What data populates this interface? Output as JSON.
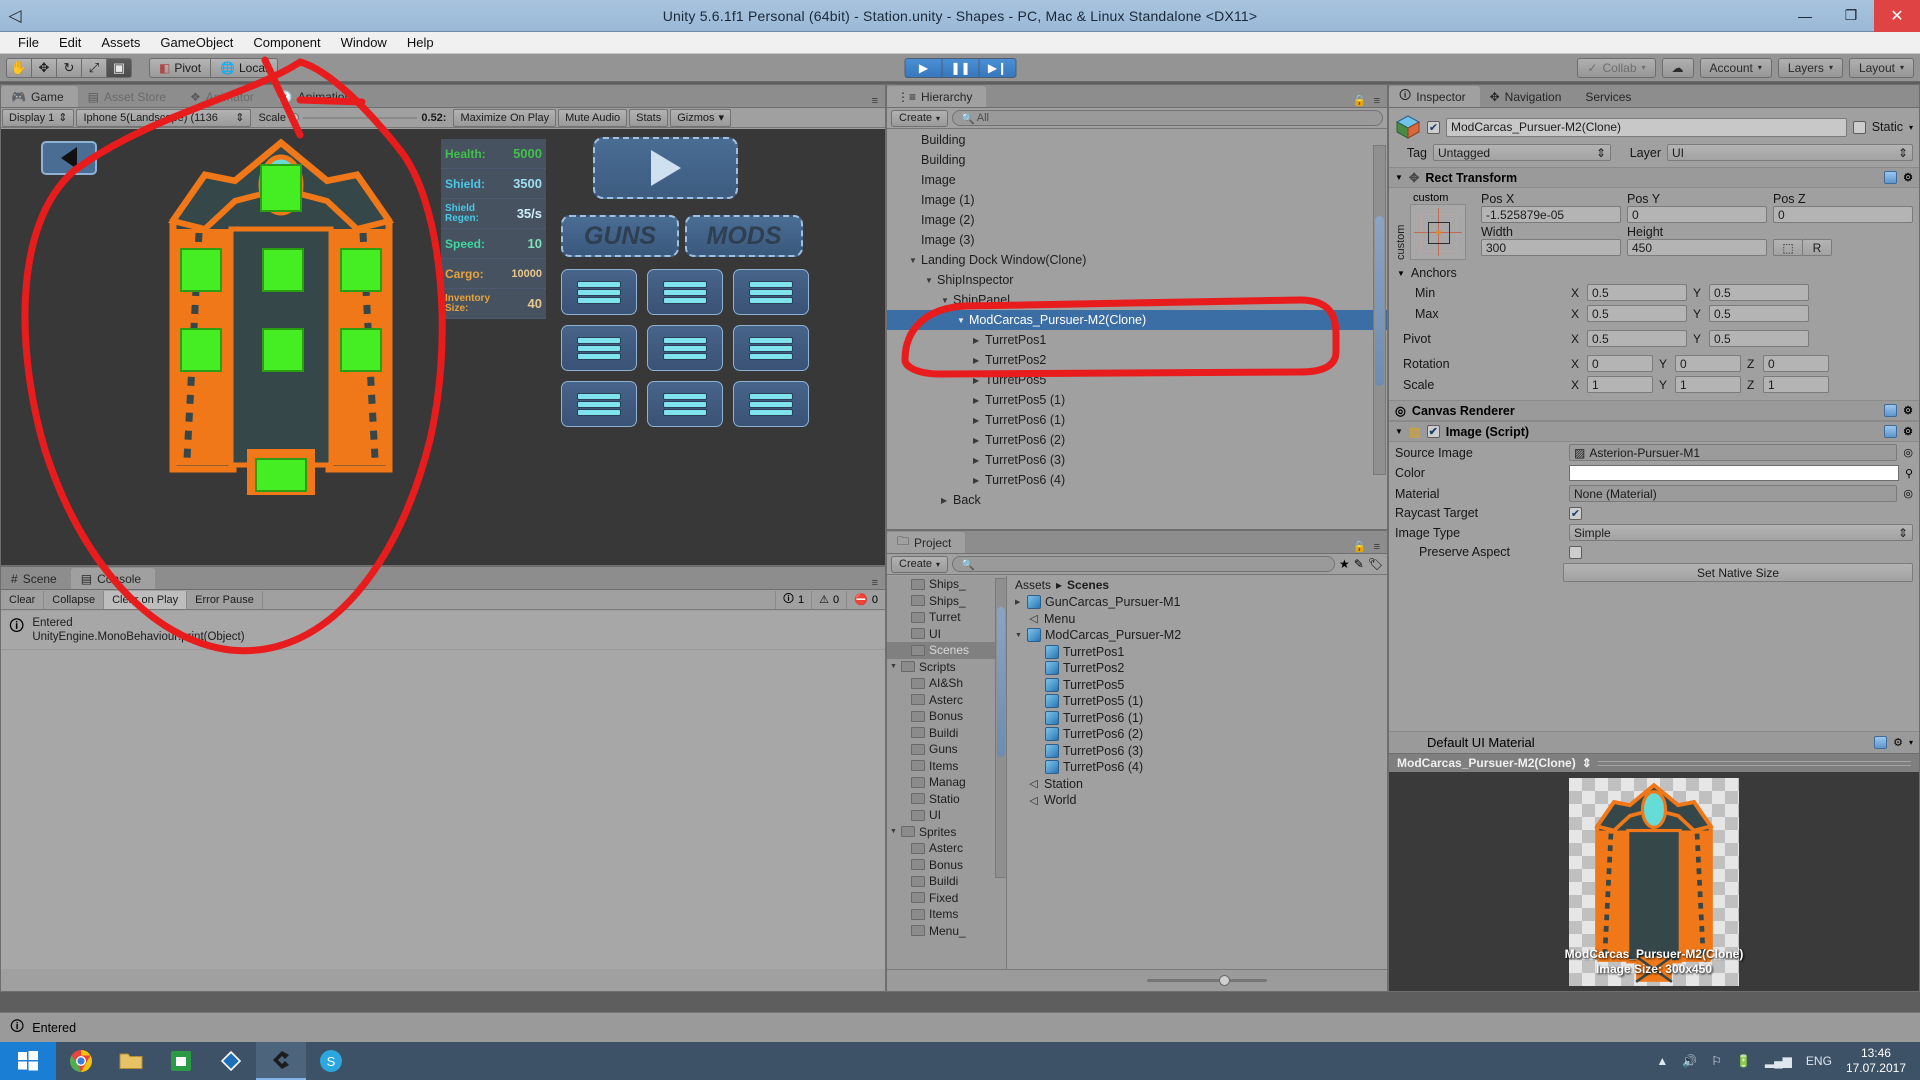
{
  "window": {
    "title": "Unity 5.6.1f1 Personal (64bit) - Station.unity - Shapes - PC, Mac & Linux Standalone <DX11>",
    "minimize": "—",
    "maximize": "❐",
    "close": "✕"
  },
  "menu": [
    "File",
    "Edit",
    "Assets",
    "GameObject",
    "Component",
    "Window",
    "Help"
  ],
  "toolbar": {
    "tools": [
      "hand-tool",
      "move-tool",
      "rotate-tool",
      "scale-tool",
      "rect-tool"
    ],
    "pivot_label": "Pivot",
    "local_label": "Local",
    "play": "▶",
    "pause": "❚❚",
    "step": "▶❙",
    "collab_label": "Collab",
    "account_label": "Account",
    "layers_label": "Layers",
    "layout_label": "Layout"
  },
  "game_view": {
    "tabs": [
      "Game",
      "Asset Store",
      "Animator",
      "Animation"
    ],
    "selected_tab": "Game",
    "display": "Display 1",
    "resolution": "Iphone 5(Landscape) (1136",
    "scale_label": "Scale",
    "scale_value": "0.52:",
    "maximize_on_play": "Maximize On Play",
    "mute_audio": "Mute Audio",
    "stats": "Stats",
    "gizmos": "Gizmos",
    "ship_stats": [
      {
        "label": "Health:",
        "value": "5000",
        "color": "#3fc14a"
      },
      {
        "label": "Shield:",
        "value": "3500",
        "color": "#49c8e8"
      },
      {
        "label": "Shield Regen:",
        "value": "35/s",
        "color": "#49c8e8"
      },
      {
        "label": "Speed:",
        "value": "10",
        "color": "#3fd6a0"
      },
      {
        "label": "Cargo:",
        "value": "10000",
        "color": "#e8a33d"
      },
      {
        "label": "Inventory Size:",
        "value": "40",
        "color": "#e8a33d"
      }
    ],
    "panel_tabs": [
      "GUNS",
      "MODS"
    ],
    "slot_count": 9
  },
  "console": {
    "tabs": [
      "Scene",
      "Console"
    ],
    "selected_tab": "Console",
    "buttons": [
      "Clear",
      "Collapse",
      "Clear on Play",
      "Error Pause"
    ],
    "counts": {
      "info": "1",
      "warning": "0",
      "error": "0"
    },
    "entries": [
      {
        "line1": "Entered",
        "line2": "UnityEngine.MonoBehaviour:print(Object)"
      }
    ],
    "status": "Entered"
  },
  "hierarchy": {
    "tab": "Hierarchy",
    "create_label": "Create",
    "search_placeholder": "All",
    "items": [
      {
        "label": "Building",
        "indent": 1,
        "arrow": "",
        "selected": false
      },
      {
        "label": "Building",
        "indent": 1,
        "arrow": "",
        "selected": false
      },
      {
        "label": "Image",
        "indent": 1,
        "arrow": "",
        "selected": false
      },
      {
        "label": "Image (1)",
        "indent": 1,
        "arrow": "",
        "selected": false
      },
      {
        "label": "Image (2)",
        "indent": 1,
        "arrow": "",
        "selected": false
      },
      {
        "label": "Image (3)",
        "indent": 1,
        "arrow": "",
        "selected": false
      },
      {
        "label": "Landing Dock Window(Clone)",
        "indent": 1,
        "arrow": "▼",
        "selected": false
      },
      {
        "label": "ShipInspector",
        "indent": 2,
        "arrow": "▼",
        "selected": false
      },
      {
        "label": "ShipPanel",
        "indent": 3,
        "arrow": "▼",
        "selected": false
      },
      {
        "label": "ModCarcas_Pursuer-M2(Clone)",
        "indent": 4,
        "arrow": "▼",
        "selected": true
      },
      {
        "label": "TurretPos1",
        "indent": 5,
        "arrow": "▶",
        "selected": false
      },
      {
        "label": "TurretPos2",
        "indent": 5,
        "arrow": "▶",
        "selected": false
      },
      {
        "label": "TurretPos5",
        "indent": 5,
        "arrow": "▶",
        "selected": false
      },
      {
        "label": "TurretPos5 (1)",
        "indent": 5,
        "arrow": "▶",
        "selected": false
      },
      {
        "label": "TurretPos6 (1)",
        "indent": 5,
        "arrow": "▶",
        "selected": false
      },
      {
        "label": "TurretPos6 (2)",
        "indent": 5,
        "arrow": "▶",
        "selected": false
      },
      {
        "label": "TurretPos6 (3)",
        "indent": 5,
        "arrow": "▶",
        "selected": false
      },
      {
        "label": "TurretPos6 (4)",
        "indent": 5,
        "arrow": "▶",
        "selected": false
      },
      {
        "label": "Back",
        "indent": 3,
        "arrow": "▶",
        "selected": false
      }
    ]
  },
  "project": {
    "tab": "Project",
    "create_label": "Create",
    "search_placeholder": "",
    "tree": [
      {
        "label": "Ships_",
        "indent": 1,
        "arrow": "",
        "selected": false
      },
      {
        "label": "Ships_",
        "indent": 1,
        "arrow": "",
        "selected": false
      },
      {
        "label": "Turret",
        "indent": 1,
        "arrow": "",
        "selected": false
      },
      {
        "label": "UI",
        "indent": 1,
        "arrow": "",
        "selected": false
      },
      {
        "label": "Scenes",
        "indent": 1,
        "arrow": "",
        "selected": true
      },
      {
        "label": "Scripts",
        "indent": 0,
        "arrow": "▼",
        "selected": false
      },
      {
        "label": "AI&Sh",
        "indent": 1,
        "arrow": "",
        "selected": false
      },
      {
        "label": "Asterc",
        "indent": 1,
        "arrow": "",
        "selected": false
      },
      {
        "label": "Bonus",
        "indent": 1,
        "arrow": "",
        "selected": false
      },
      {
        "label": "Buildi",
        "indent": 1,
        "arrow": "",
        "selected": false
      },
      {
        "label": "Guns",
        "indent": 1,
        "arrow": "",
        "selected": false
      },
      {
        "label": "Items",
        "indent": 1,
        "arrow": "",
        "selected": false
      },
      {
        "label": "Manag",
        "indent": 1,
        "arrow": "",
        "selected": false
      },
      {
        "label": "Statio",
        "indent": 1,
        "arrow": "",
        "selected": false
      },
      {
        "label": "UI",
        "indent": 1,
        "arrow": "",
        "selected": false
      },
      {
        "label": "Sprites",
        "indent": 0,
        "arrow": "▼",
        "selected": false
      },
      {
        "label": "Asterc",
        "indent": 1,
        "arrow": "",
        "selected": false
      },
      {
        "label": "Bonus",
        "indent": 1,
        "arrow": "",
        "selected": false
      },
      {
        "label": "Buildi",
        "indent": 1,
        "arrow": "",
        "selected": false
      },
      {
        "label": "Fixed",
        "indent": 1,
        "arrow": "",
        "selected": false
      },
      {
        "label": "Items",
        "indent": 1,
        "arrow": "",
        "selected": false
      },
      {
        "label": "Menu_",
        "indent": 1,
        "arrow": "",
        "selected": false
      }
    ],
    "breadcrumb": [
      "Assets",
      "Scenes"
    ],
    "contents": [
      {
        "label": "GunCarcas_Pursuer-M1",
        "indent": 0,
        "arrow": "▶",
        "icon": "prefab-cube"
      },
      {
        "label": "Menu",
        "indent": 0,
        "arrow": "",
        "icon": "unity-scene"
      },
      {
        "label": "ModCarcas_Pursuer-M2",
        "indent": 0,
        "arrow": "▼",
        "icon": "prefab-cube"
      },
      {
        "label": "TurretPos1",
        "indent": 1,
        "arrow": "",
        "icon": "prefab-cube"
      },
      {
        "label": "TurretPos2",
        "indent": 1,
        "arrow": "",
        "icon": "prefab-cube"
      },
      {
        "label": "TurretPos5",
        "indent": 1,
        "arrow": "",
        "icon": "prefab-cube"
      },
      {
        "label": "TurretPos5 (1)",
        "indent": 1,
        "arrow": "",
        "icon": "prefab-cube"
      },
      {
        "label": "TurretPos6 (1)",
        "indent": 1,
        "arrow": "",
        "icon": "prefab-cube"
      },
      {
        "label": "TurretPos6 (2)",
        "indent": 1,
        "arrow": "",
        "icon": "prefab-cube"
      },
      {
        "label": "TurretPos6 (3)",
        "indent": 1,
        "arrow": "",
        "icon": "prefab-cube"
      },
      {
        "label": "TurretPos6 (4)",
        "indent": 1,
        "arrow": "",
        "icon": "prefab-cube"
      },
      {
        "label": "Station",
        "indent": 0,
        "arrow": "",
        "icon": "unity-scene"
      },
      {
        "label": "World",
        "indent": 0,
        "arrow": "",
        "icon": "unity-scene"
      }
    ]
  },
  "inspector": {
    "tabs": [
      "Inspector",
      "Navigation",
      "Services"
    ],
    "selected_tab": "Inspector",
    "object_name": "ModCarcas_Pursuer-M2(Clone)",
    "object_enabled": true,
    "static_label": "Static",
    "tag_label": "Tag",
    "tag_value": "Untagged",
    "layer_label": "Layer",
    "layer_value": "UI",
    "rect_transform": {
      "title": "Rect Transform",
      "anchor_preset": "custom",
      "anchor_preset_vertical": "custom",
      "pos_x_label": "Pos X",
      "pos_x": "-1.525879e-05",
      "pos_y_label": "Pos Y",
      "pos_y": "0",
      "pos_z_label": "Pos Z",
      "pos_z": "0",
      "width_label": "Width",
      "width": "300",
      "height_label": "Height",
      "height": "450",
      "blueprint_btn": "⬚",
      "raw_btn": "R",
      "anchors_label": "Anchors",
      "min_label": "Min",
      "min_x": "0.5",
      "min_y": "0.5",
      "max_label": "Max",
      "max_x": "0.5",
      "max_y": "0.5",
      "pivot_label": "Pivot",
      "pivot_x": "0.5",
      "pivot_y": "0.5",
      "rotation_label": "Rotation",
      "rot_x": "0",
      "rot_y": "0",
      "rot_z": "0",
      "scale_label": "Scale",
      "scale_x": "1",
      "scale_y": "1",
      "scale_z": "1"
    },
    "canvas_renderer": {
      "title": "Canvas Renderer"
    },
    "image_script": {
      "title": "Image (Script)",
      "enabled": true,
      "source_image_label": "Source Image",
      "source_image": "Asterion-Pursuer-M1",
      "color_label": "Color",
      "color_value": "#FFFFFF",
      "material_label": "Material",
      "material_value": "None (Material)",
      "raycast_label": "Raycast Target",
      "raycast_checked": true,
      "image_type_label": "Image Type",
      "image_type_value": "Simple",
      "preserve_aspect_label": "Preserve Aspect",
      "preserve_aspect_checked": false,
      "set_native_size_label": "Set Native Size"
    },
    "material_footer": "Default UI Material",
    "preview": {
      "title": "ModCarcas_Pursuer-M2(Clone)",
      "caption_name": "ModCarcas_Pursuer-M2(Clone)",
      "caption_size": "Image Size: 300x450"
    }
  },
  "status_bar": {
    "text": "Entered"
  },
  "taskbar": {
    "apps": [
      "chrome",
      "explorer",
      "store",
      "vscode",
      "unity",
      "skype"
    ],
    "language": "ENG",
    "time": "13:46",
    "date": "17.07.2017"
  },
  "colors": {
    "accent_blue": "#3a6ea5",
    "ship_orange": "#f07818",
    "ship_body": "#36474a",
    "cockpit_cyan": "#66dcd6",
    "annotation_red": "#e81c1c"
  }
}
